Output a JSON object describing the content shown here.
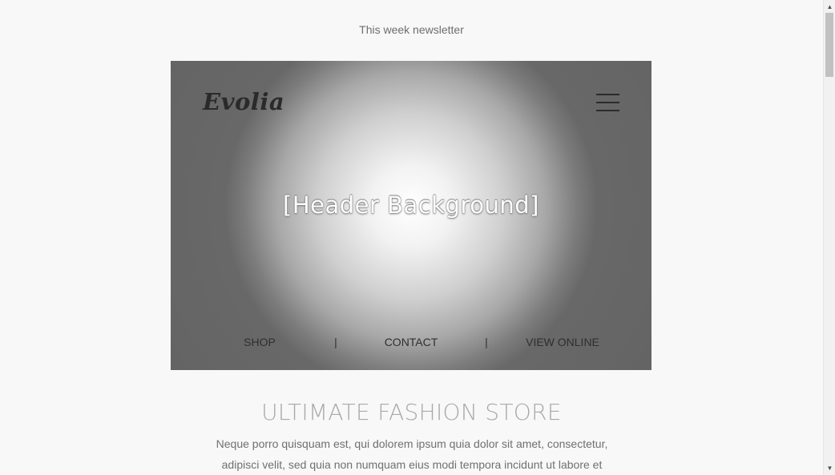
{
  "preheader": {
    "text": "This week newsletter"
  },
  "hero": {
    "logo": "Evolia",
    "background_label": "[Header Background]",
    "nav": {
      "items": [
        {
          "label": "SHOP"
        },
        {
          "label": "CONTACT"
        },
        {
          "label": "VIEW ONLINE"
        }
      ],
      "separator": "|"
    }
  },
  "section": {
    "title": "ULTIMATE FASHION STORE",
    "body": "Neque porro quisquam est, qui dolorem ipsum quia dolor sit amet, consectetur, adipisci velit, sed quia non numquam eius modi tempora incidunt ut labore et"
  },
  "scrollbar": {
    "up_icon": "triangle-up",
    "down_icon": "triangle-down"
  },
  "colors": {
    "page_background": "#f8f8f8",
    "hero_dark": "#646464",
    "title_gray": "#a9a9a9",
    "body_gray": "#707070"
  }
}
